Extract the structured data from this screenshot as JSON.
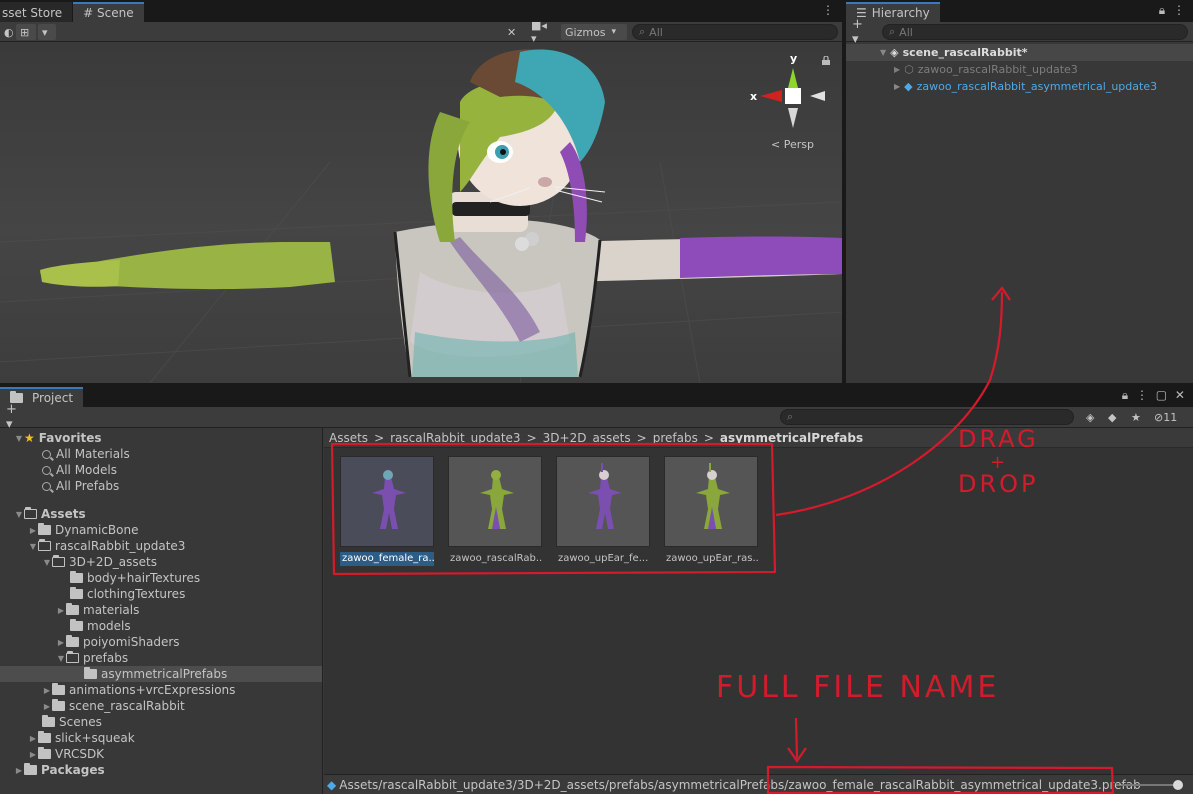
{
  "scene_tabs": [
    {
      "label": "sset Store"
    },
    {
      "label": "# Scene"
    }
  ],
  "scene_toolbar": {
    "gizmos_label": "Gizmos",
    "search_placeholder": "All"
  },
  "scene_view": {
    "persp_label": "< Persp",
    "axis_y": "y",
    "axis_x": "x"
  },
  "hierarchy": {
    "tab_label": "Hierarchy",
    "search_placeholder": "All",
    "items": [
      {
        "label": "scene_rascalRabbit*"
      },
      {
        "label": "zawoo_rascalRabbit_update3"
      },
      {
        "label": "zawoo_rascalRabbit_asymmetrical_update3"
      }
    ]
  },
  "project": {
    "tab_label": "Project",
    "hidden_count": "11",
    "tree": [
      {
        "label": "Favorites"
      },
      {
        "label": "All Materials"
      },
      {
        "label": "All Models"
      },
      {
        "label": "All Prefabs"
      },
      {
        "label": "Assets"
      },
      {
        "label": "DynamicBone"
      },
      {
        "label": "rascalRabbit_update3"
      },
      {
        "label": "3D+2D_assets"
      },
      {
        "label": "body+hairTextures"
      },
      {
        "label": "clothingTextures"
      },
      {
        "label": "materials"
      },
      {
        "label": "models"
      },
      {
        "label": "poiyomiShaders"
      },
      {
        "label": "prefabs"
      },
      {
        "label": "asymmetricalPrefabs"
      },
      {
        "label": "animations+vrcExpressions"
      },
      {
        "label": "scene_rascalRabbit"
      },
      {
        "label": "Scenes"
      },
      {
        "label": "slick+squeak"
      },
      {
        "label": "VRCSDK"
      },
      {
        "label": "Packages"
      }
    ],
    "breadcrumb": [
      {
        "label": "Assets"
      },
      {
        "label": "rascalRabbit_update3"
      },
      {
        "label": "3D+2D_assets"
      },
      {
        "label": "prefabs"
      },
      {
        "label": "asymmetricalPrefabs"
      }
    ],
    "breadcrumb_separator": ">",
    "assets": [
      {
        "label": "zawoo_female_ra..."
      },
      {
        "label": "zawoo_rascalRab..."
      },
      {
        "label": "zawoo_upEar_fe..."
      },
      {
        "label": "zawoo_upEar_ras..."
      }
    ],
    "status_path": "Assets/rascalRabbit_update3/3D+2D_assets/prefabs/asymmetricalPrefabs/",
    "status_file": "zawoo_female_rascalRabbit_asymmetrical_update3.prefab"
  },
  "annotations": {
    "drag_drop_line1": "DRAG",
    "drag_drop_plus": "+",
    "drag_drop_line2": "DROP",
    "full_file_name": "FULL FILE NAME"
  },
  "colors": {
    "annotation_red": "#d31b2c",
    "selection_blue": "#2c5d87",
    "prefab_blue": "#4ea9e6"
  }
}
